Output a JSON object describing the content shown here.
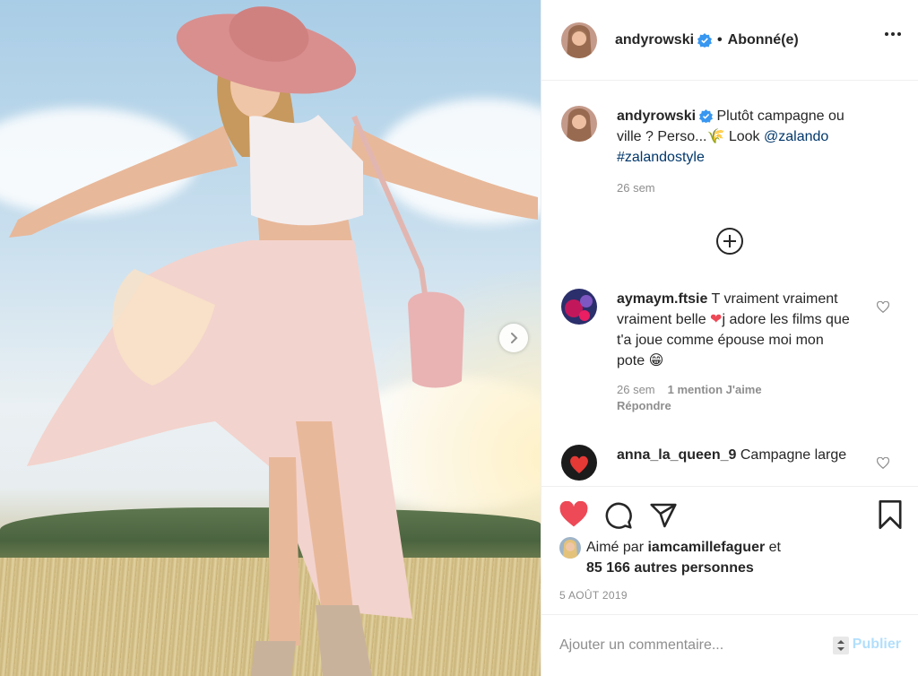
{
  "post": {
    "photo_alt": "",
    "header": {
      "username": "andyrowski",
      "separator": "•",
      "follow_label": "Abonné(e)"
    },
    "caption": {
      "username": "andyrowski",
      "text": "Plutôt campagne ou ville ? Perso...",
      "emoji": "🌾",
      "look_text": " Look ",
      "mention": "@zalando",
      "hashtag": "#zalandostyle",
      "time": "26 sem"
    },
    "comments": [
      {
        "username": "aymaym.ftsie",
        "text_before": "T vraiment vraiment vraiment belle ",
        "emoji_heart": "❤",
        "text_after": "j adore les films que t'a joue comme épouse moi mon pote ",
        "emoji_end": "😁",
        "time": "26 sem",
        "likes": "1 mention J'aime",
        "reply_label": "Répondre"
      },
      {
        "username": "anna_la_queen_9",
        "text": "Campagne large"
      }
    ],
    "likes": {
      "prefix": "Aimé par ",
      "first_liker": "iamcamillefaguer",
      "connector": " et",
      "others": "85 166 autres personnes"
    },
    "date": "5 AOÛT 2019",
    "add_comment": {
      "placeholder": "Ajouter un commentaire...",
      "publish_label": "Publier"
    },
    "icons": {
      "like": "heart-filled-icon",
      "comment": "comment-icon",
      "share": "share-icon",
      "save": "bookmark-icon",
      "more": "more-options-icon",
      "next": "chevron-right-icon",
      "load_more": "plus-circle-icon",
      "verified": "verified-badge-icon"
    },
    "colors": {
      "like_red": "#ed4956",
      "verified_blue": "#3897f0",
      "link_blue": "#00376b",
      "publish_disabled": "#b2dffc",
      "muted": "#8e8e8e"
    }
  }
}
